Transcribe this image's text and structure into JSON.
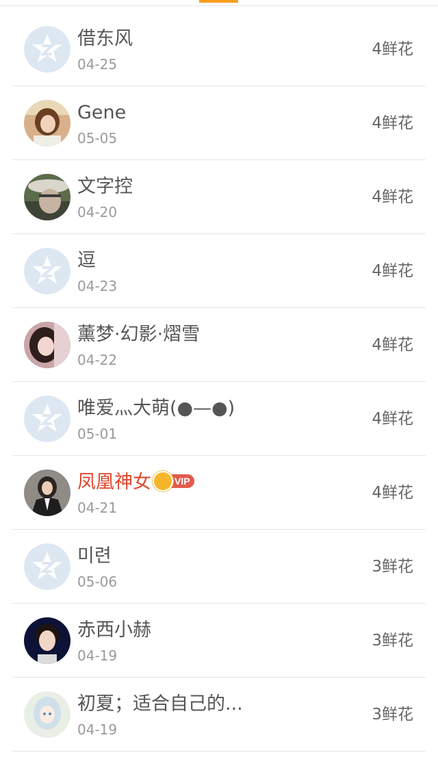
{
  "colors": {
    "tab_indicator": "#f79f1f",
    "vip_name": "#e0452b",
    "vip_tag_bg": "#e25a4c",
    "default_avatar_bg": "#dde7f2"
  },
  "list": [
    {
      "name": "借东风",
      "date": "04-25",
      "flowers": "4鲜花",
      "avatar": "default-qq-avatar",
      "vip": false
    },
    {
      "name": "Gene",
      "date": "05-05",
      "flowers": "4鲜花",
      "avatar": "photo-girl-avatar",
      "vip": false
    },
    {
      "name": "文字控",
      "date": "04-20",
      "flowers": "4鲜花",
      "avatar": "photo-man-hat-avatar",
      "vip": false
    },
    {
      "name": "逗",
      "date": "04-23",
      "flowers": "4鲜花",
      "avatar": "default-qq-avatar",
      "vip": false
    },
    {
      "name": "薰梦·幻影·熠雪",
      "date": "04-22",
      "flowers": "4鲜花",
      "avatar": "photo-girl-avatar",
      "vip": false
    },
    {
      "name": "唯爱灬大萌(●—●)",
      "date": "05-01",
      "flowers": "4鲜花",
      "avatar": "default-qq-avatar",
      "vip": false
    },
    {
      "name": "凤凰神女",
      "date": "04-21",
      "flowers": "4鲜花",
      "avatar": "photo-woman-suit-avatar",
      "vip": true,
      "vip_label": "VIP"
    },
    {
      "name": "미련",
      "date": "05-06",
      "flowers": "3鲜花",
      "avatar": "default-qq-avatar",
      "vip": false
    },
    {
      "name": "赤西小赫",
      "date": "04-19",
      "flowers": "3鲜花",
      "avatar": "photo-boy-avatar",
      "vip": false
    },
    {
      "name": "初夏；适合自己的...",
      "date": "04-19",
      "flowers": "3鲜花",
      "avatar": "anime-girl-avatar",
      "vip": false
    }
  ]
}
